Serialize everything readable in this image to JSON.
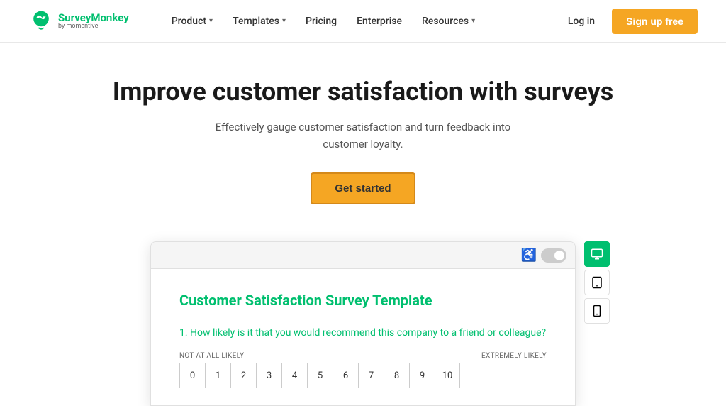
{
  "brand": {
    "name": "SurveyMonkey",
    "sub": "by momentive",
    "logo_alt": "SurveyMonkey logo"
  },
  "nav": {
    "items": [
      {
        "label": "Product",
        "has_dropdown": true
      },
      {
        "label": "Templates",
        "has_dropdown": true
      },
      {
        "label": "Pricing",
        "has_dropdown": false
      },
      {
        "label": "Enterprise",
        "has_dropdown": false
      },
      {
        "label": "Resources",
        "has_dropdown": true
      }
    ],
    "login_label": "Log in",
    "signup_label": "Sign up free"
  },
  "hero": {
    "title": "Improve customer satisfaction with surveys",
    "subtitle": "Effectively gauge customer satisfaction and turn feedback into customer loyalty.",
    "cta_label": "Get started"
  },
  "preview": {
    "survey_title": "Customer Satisfaction Survey Template",
    "question_number": "1.",
    "question_text": "How likely is it that you would recommend this company to a friend or colleague?",
    "scale": {
      "left_label": "NOT AT ALL LIKELY",
      "right_label": "EXTREMELY LIKELY",
      "numbers": [
        "0",
        "1",
        "2",
        "3",
        "4",
        "5",
        "6",
        "7",
        "8",
        "9",
        "10"
      ]
    },
    "devices": [
      "desktop",
      "tablet",
      "mobile"
    ]
  }
}
